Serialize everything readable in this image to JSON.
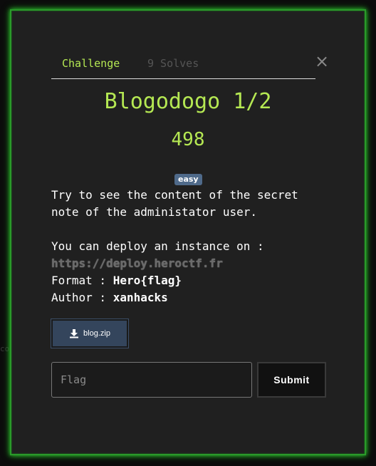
{
  "background_fragment": "co",
  "tabs": [
    {
      "label": "Challenge"
    },
    {
      "label": "9 Solves"
    }
  ],
  "close_glyph": "×",
  "challenge": {
    "name": "Blogodogo 1/2",
    "points": "498",
    "difficulty": "easy"
  },
  "description": {
    "line1": "Try to see the content of the secret",
    "line2": "note of the administator user.",
    "line3": "You can deploy an instance on :",
    "url": "https://deploy.heroctf.fr",
    "format_label": "Format : ",
    "format_value": "Hero{flag}",
    "author_label": "Author : ",
    "author_value": "xanhacks"
  },
  "file": {
    "label": "blog.zip",
    "icon": "download-icon"
  },
  "form": {
    "placeholder": "Flag",
    "value": "",
    "submit_label": "Submit"
  },
  "colors": {
    "accent": "#b5e853",
    "border_glow": "#2ec12e",
    "badge": "#4f6a8a",
    "file_button": "#34455c"
  }
}
